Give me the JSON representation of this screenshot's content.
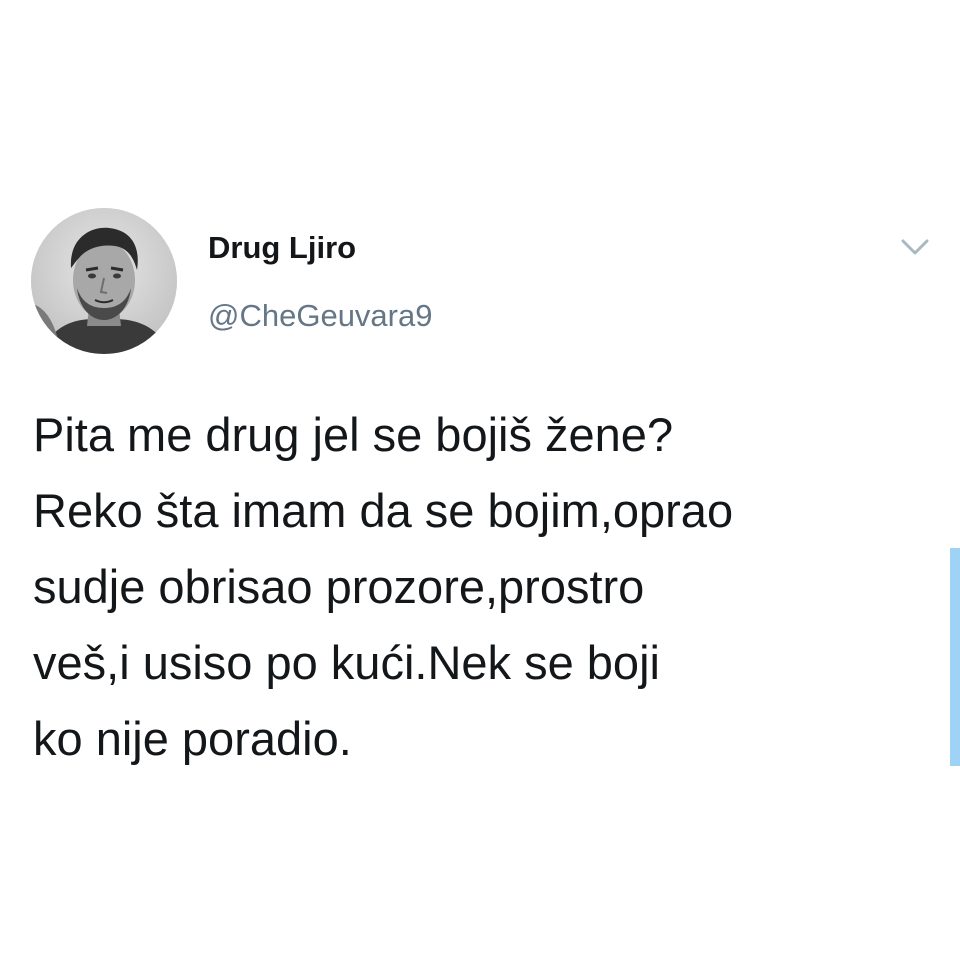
{
  "author": {
    "display_name": "Drug Ljiro",
    "handle": "@CheGeuvara9"
  },
  "tweet": {
    "text": "Pita me drug jel se bojiš žene?\nReko šta imam da se bojim,oprao\nsudje obrisao prozore,prostro\nveš,i usiso po kući.Nek se boji\nko nije poradio."
  },
  "icons": {
    "menu": "chevron-down-icon",
    "avatar": "profile-photo"
  },
  "colors": {
    "text": "#14171a",
    "handle": "#657786",
    "chevron": "#aab8c2",
    "scrollbar": "#9fd3f5",
    "background": "#ffffff"
  }
}
